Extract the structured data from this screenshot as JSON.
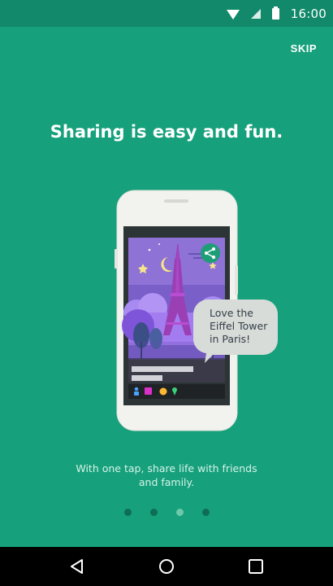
{
  "status_bar": {
    "time": "16:00",
    "icons": [
      "wifi-icon",
      "signal-icon",
      "battery-icon"
    ]
  },
  "header": {
    "skip_label": "SKIP"
  },
  "onboarding": {
    "headline": "Sharing is easy and fun.",
    "speech_bubble": [
      "Love the",
      "Eiffel Tower",
      "in Paris!"
    ],
    "caption_lines": [
      "With one tap, share life with friends",
      "and family."
    ],
    "page_count": 4,
    "active_page": 3
  },
  "nav_bar": {
    "icons": [
      "back-icon",
      "home-icon",
      "recents-icon"
    ]
  },
  "colors": {
    "background": "#16a07b",
    "status_bar": "#12896a",
    "accent": "#1e9e77"
  }
}
